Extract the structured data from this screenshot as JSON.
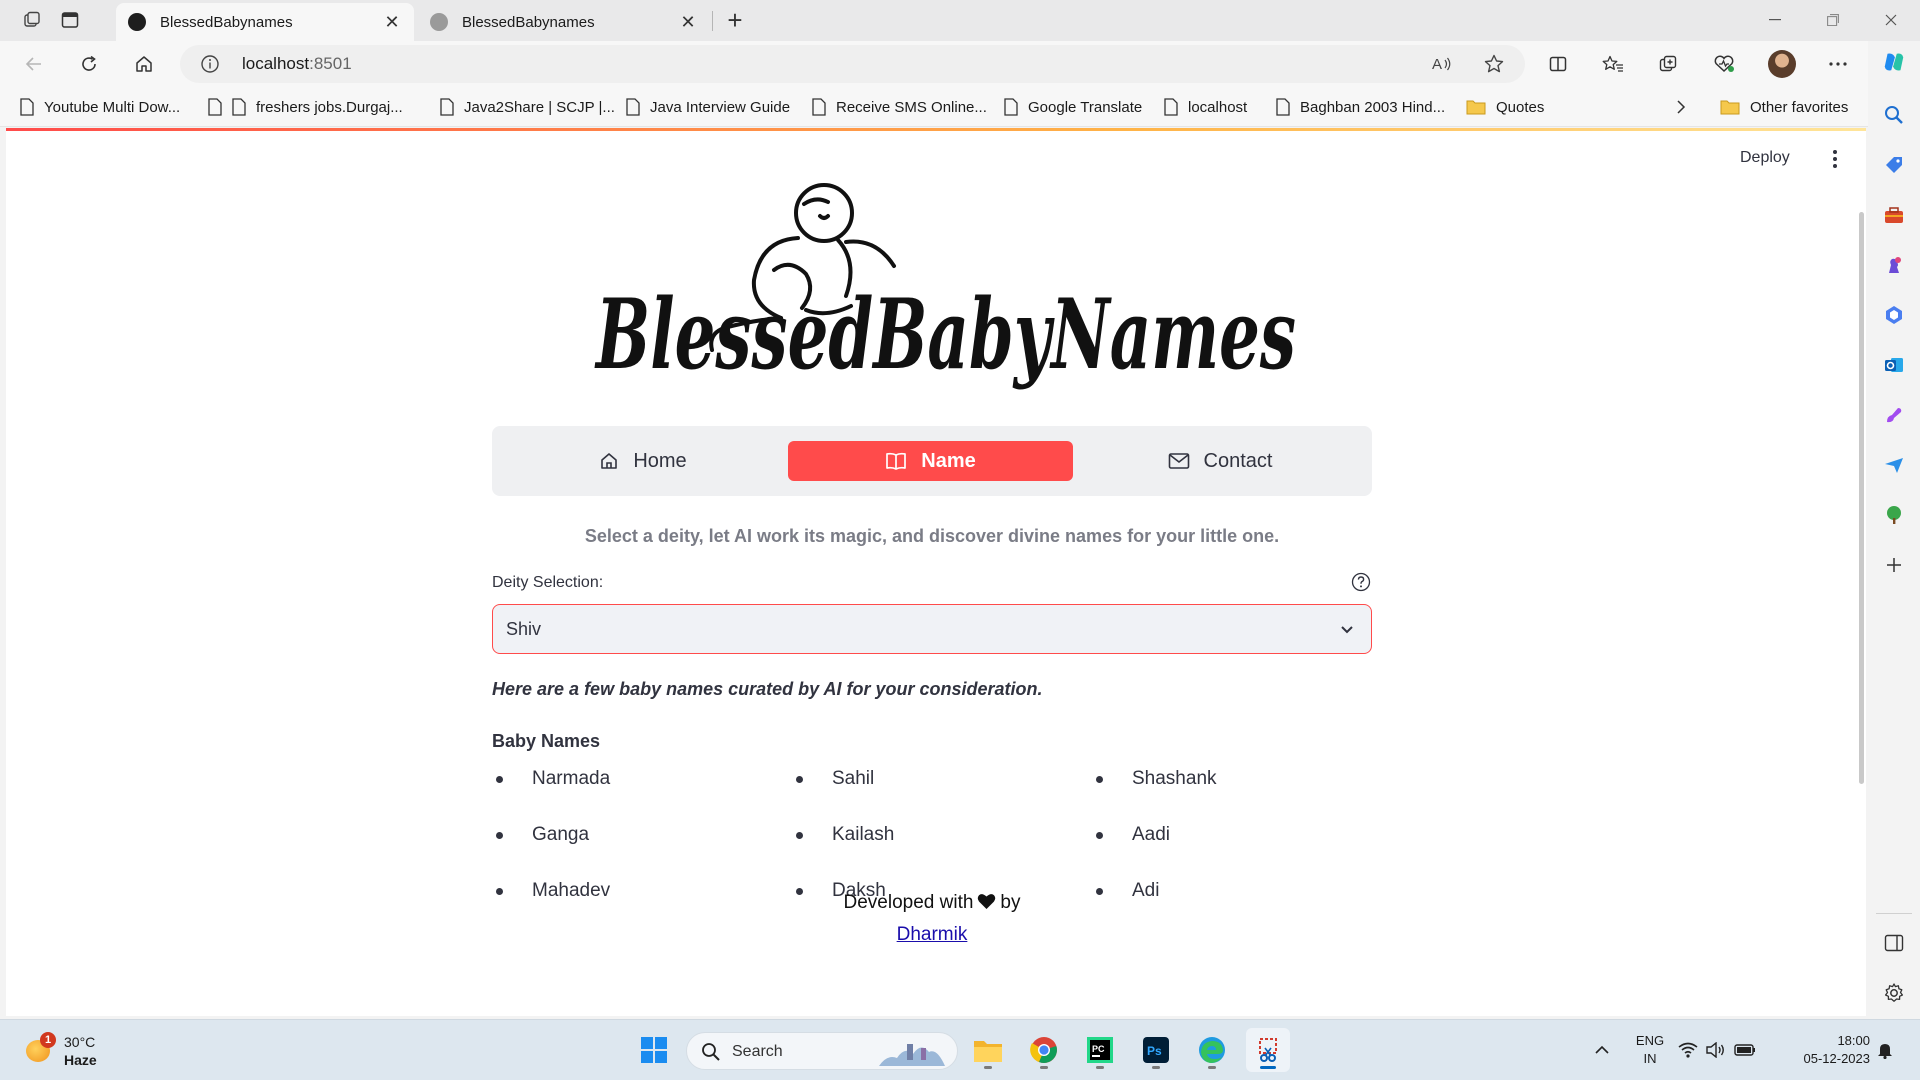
{
  "browser": {
    "tabs": [
      {
        "title": "BlessedBabynames",
        "active": true
      },
      {
        "title": "BlessedBabynames",
        "active": false
      }
    ],
    "address": {
      "host": "localhost",
      "port": ":8501"
    },
    "bookmarks": [
      "Youtube Multi Dow...",
      "freshers jobs.Durgaj...",
      "Java2Share | SCJP |...",
      "Java Interview Guide",
      "Receive SMS Online...",
      "Google Translate",
      "localhost",
      "Baghban 2003 Hind...",
      "Quotes"
    ],
    "other_favorites": "Other favorites"
  },
  "app": {
    "deploy_label": "Deploy",
    "nav": [
      {
        "label": "Home",
        "icon": "house-icon"
      },
      {
        "label": "Name",
        "icon": "book-icon",
        "active": true
      },
      {
        "label": "Contact",
        "icon": "envelope-icon"
      }
    ],
    "tagline": "Select a deity, let AI work its magic, and discover divine names for your little one.",
    "deity_label": "Deity Selection:",
    "deity_value": "Shiv",
    "curated_text": "Here are a few baby names curated by AI for your consideration.",
    "names_title": "Baby Names",
    "names_columns": [
      [
        "Narmada",
        "Ganga",
        "Mahadev"
      ],
      [
        "Sahil",
        "Kailash",
        "Daksh"
      ],
      [
        "Shashank",
        "Aadi",
        "Adi"
      ]
    ],
    "footer_text_a": "Developed with",
    "footer_text_b": "by",
    "footer_link": "Dharmik",
    "logo_text": "BlessedBabyNames"
  },
  "taskbar": {
    "weather": {
      "temp": "30°C",
      "condition": "Haze",
      "badge": "1"
    },
    "search_placeholder": "Search",
    "lang": {
      "line1": "ENG",
      "line2": "IN"
    },
    "clock": {
      "time": "18:00",
      "date": "05-12-2023"
    }
  },
  "colors": {
    "accent": "#ff4b4b",
    "select_bg": "#f0f2f6",
    "nav_bg": "#eff0f2",
    "link": "#1a0dab"
  }
}
